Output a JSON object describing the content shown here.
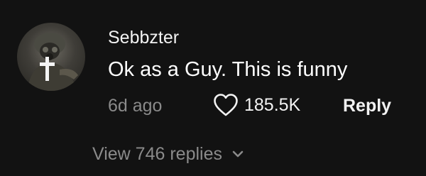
{
  "comment": {
    "avatar_icon": "user-avatar-soldier-with-cross",
    "username": "Sebbzter",
    "text": "Ok as a Guy. This is funny",
    "timestamp": "6d ago",
    "likes": {
      "icon": "heart-outline-icon",
      "count": "185.5K"
    },
    "reply_label": "Reply",
    "view_replies": {
      "label": "View 746 replies",
      "icon": "chevron-down-icon"
    }
  },
  "colors": {
    "background": "#121212",
    "primary_text": "#f2f2f2",
    "secondary_text": "#8a8a8a"
  }
}
